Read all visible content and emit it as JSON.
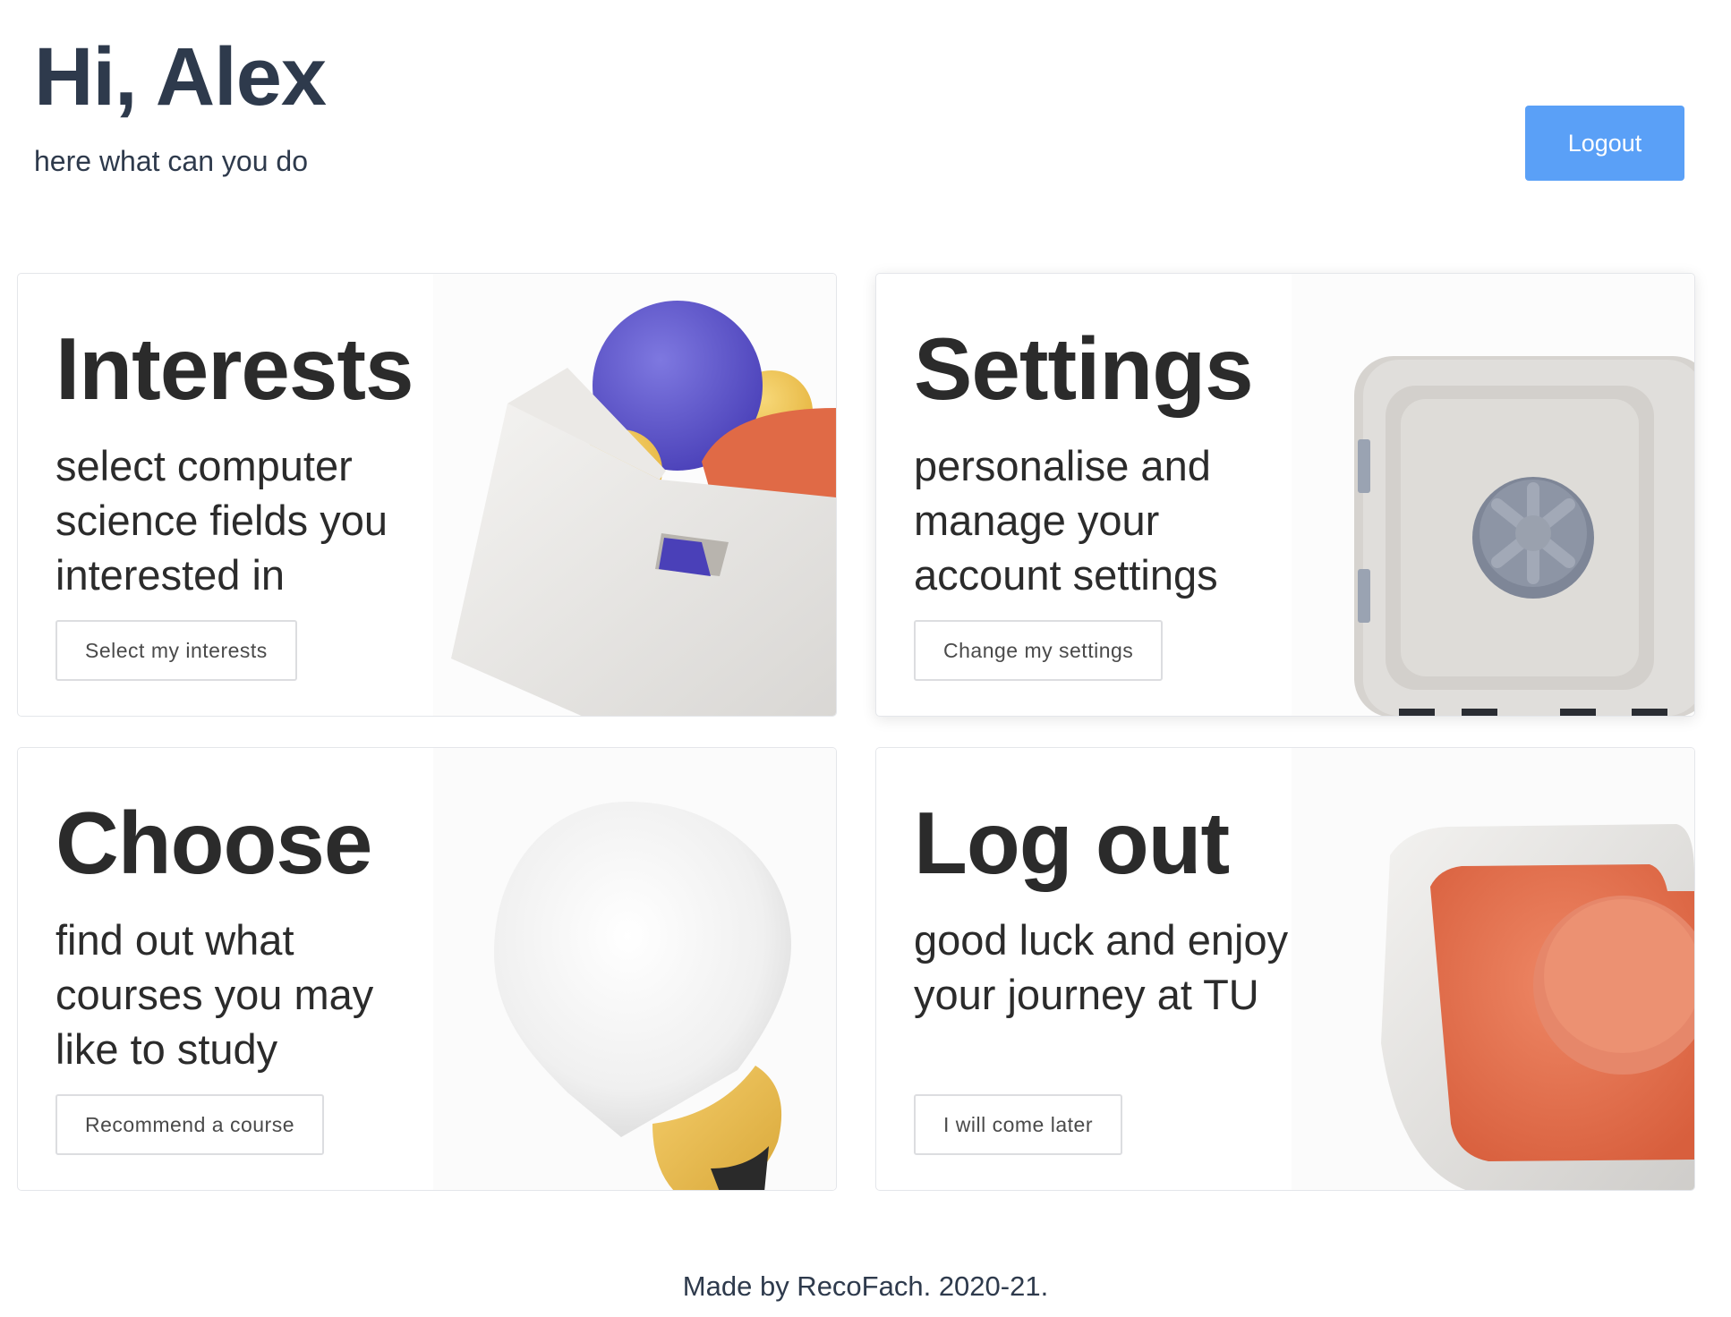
{
  "header": {
    "greeting": "Hi, Alex",
    "subtitle": "here what can you do",
    "logout_label": "Logout"
  },
  "cards": [
    {
      "title": "Interests",
      "description": "select computer science fields you interested in",
      "button_label": "Select my interests",
      "icon": "box-of-balls-icon"
    },
    {
      "title": "Settings",
      "description": "personalise and manage your account settings",
      "button_label": "Change my settings",
      "icon": "safe-icon"
    },
    {
      "title": "Choose",
      "description": "find out what courses you may like to study",
      "button_label": "Recommend a course",
      "icon": "lightbulb-icon"
    },
    {
      "title": "Log out",
      "description": "good luck and enjoy your journey at TU",
      "button_label": "I will come later",
      "icon": "red-button-icon"
    }
  ],
  "footer": {
    "text": "Made by RecoFach. 2020-21."
  },
  "colors": {
    "accent": "#5aa0f7",
    "heading": "#2e3a4c",
    "card_title": "#2b2b2b"
  }
}
